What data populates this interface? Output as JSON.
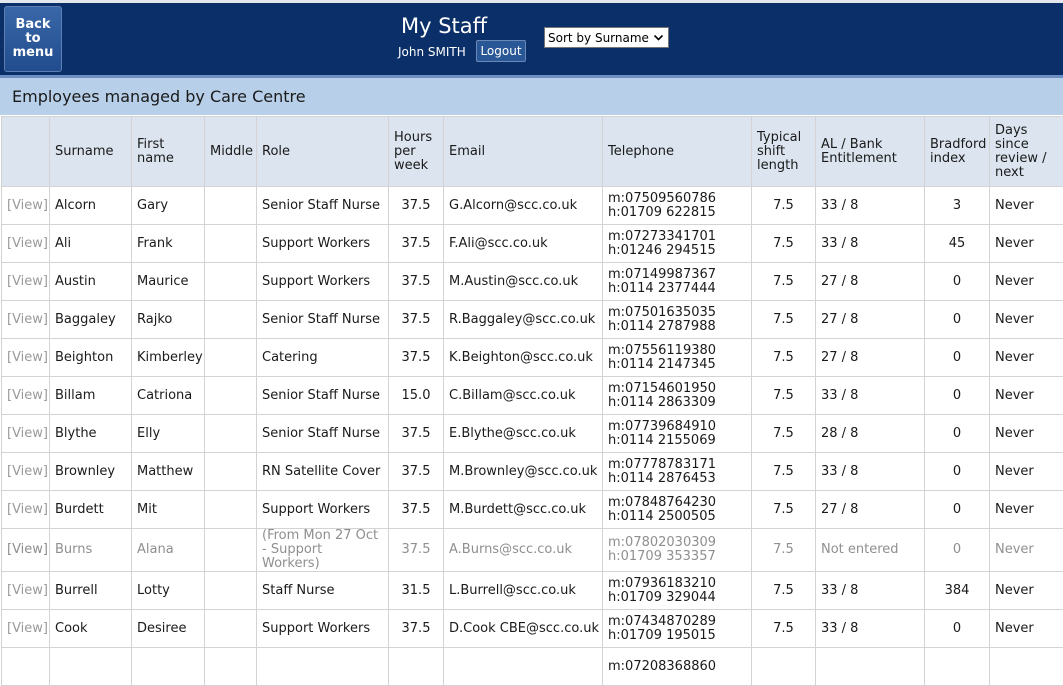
{
  "header": {
    "back_label_lines": [
      "Back",
      "to",
      "menu"
    ],
    "title": "My Staff",
    "user_name": "John SMITH",
    "logout_label": "Logout",
    "sort": {
      "selected": "Sort by Surname"
    }
  },
  "section": {
    "title": "Employees managed by Care Centre"
  },
  "table": {
    "columns": [
      "",
      "Surname",
      "First name",
      "Middle",
      "Role",
      "Hours per week",
      "Email",
      "Telephone",
      "Typical shift length",
      "AL / Bank Entitlement",
      "Bradford index",
      "Days since review / next"
    ],
    "rows": [
      {
        "view": "[View]",
        "surname": "Alcorn",
        "first": "Gary",
        "middle": "",
        "role": "Senior Staff Nurse",
        "hours": "37.5",
        "email": "G.Alcorn@scc.co.uk",
        "mobile": "m:07509560786",
        "home": "h:01709 622815",
        "shift": "7.5",
        "al": "33 / 8",
        "bradford": "3",
        "days": "Never"
      },
      {
        "view": "[View]",
        "surname": "Ali",
        "first": "Frank",
        "middle": "",
        "role": "Support Workers",
        "hours": "37.5",
        "email": "F.Ali@scc.co.uk",
        "mobile": "m:07273341701",
        "home": "h:01246 294515",
        "shift": "7.5",
        "al": "33 / 8",
        "bradford": "45",
        "days": "Never"
      },
      {
        "view": "[View]",
        "surname": "Austin",
        "first": "Maurice",
        "middle": "",
        "role": "Support Workers",
        "hours": "37.5",
        "email": "M.Austin@scc.co.uk",
        "mobile": "m:07149987367",
        "home": "h:0114 2377444",
        "shift": "7.5",
        "al": "27 / 8",
        "bradford": "0",
        "days": "Never"
      },
      {
        "view": "[View]",
        "surname": "Baggaley",
        "first": "Rajko",
        "middle": "",
        "role": "Senior Staff Nurse",
        "hours": "37.5",
        "email": "R.Baggaley@scc.co.uk",
        "mobile": "m:07501635035",
        "home": "h:0114 2787988",
        "shift": "7.5",
        "al": "27 / 8",
        "bradford": "0",
        "days": "Never"
      },
      {
        "view": "[View]",
        "surname": "Beighton",
        "first": "Kimberley",
        "middle": "",
        "role": "Catering",
        "hours": "37.5",
        "email": "K.Beighton@scc.co.uk",
        "mobile": "m:07556119380",
        "home": "h:0114 2147345",
        "shift": "7.5",
        "al": "27 / 8",
        "bradford": "0",
        "days": "Never"
      },
      {
        "view": "[View]",
        "surname": "Billam",
        "first": "Catriona",
        "middle": "",
        "role": "Senior Staff Nurse",
        "hours": "15.0",
        "email": "C.Billam@scc.co.uk",
        "mobile": "m:07154601950",
        "home": "h:0114 2863309",
        "shift": "7.5",
        "al": "33 / 8",
        "bradford": "0",
        "days": "Never"
      },
      {
        "view": "[View]",
        "surname": "Blythe",
        "first": "Elly",
        "middle": "",
        "role": "Senior Staff Nurse",
        "hours": "37.5",
        "email": "E.Blythe@scc.co.uk",
        "mobile": "m:07739684910",
        "home": "h:0114 2155069",
        "shift": "7.5",
        "al": "28 / 8",
        "bradford": "0",
        "days": "Never"
      },
      {
        "view": "[View]",
        "surname": "Brownley",
        "first": "Matthew",
        "middle": "",
        "role": "RN Satellite Cover",
        "hours": "37.5",
        "email": "M.Brownley@scc.co.uk",
        "mobile": "m:07778783171",
        "home": "h:0114 2876453",
        "shift": "7.5",
        "al": "33 / 8",
        "bradford": "0",
        "days": "Never"
      },
      {
        "view": "[View]",
        "surname": "Burdett",
        "first": "Mit",
        "middle": "",
        "role": "Support Workers",
        "hours": "37.5",
        "email": "M.Burdett@scc.co.uk",
        "mobile": "m:07848764230",
        "home": "h:0114 2500505",
        "shift": "7.5",
        "al": "27 / 8",
        "bradford": "0",
        "days": "Never"
      },
      {
        "view": "[View]",
        "surname": "Burns",
        "first": "Alana",
        "middle": "",
        "role": "(From Mon 27 Oct - Support Workers)",
        "hours": "37.5",
        "email": "A.Burns@scc.co.uk",
        "mobile": "m:07802030309",
        "home": "h:01709 353357",
        "shift": "7.5",
        "al": "Not entered",
        "bradford": "0",
        "days": "Never",
        "dim": true
      },
      {
        "view": "[View]",
        "surname": "Burrell",
        "first": "Lotty",
        "middle": "",
        "role": "Staff Nurse",
        "hours": "31.5",
        "email": "L.Burrell@scc.co.uk",
        "mobile": "m:07936183210",
        "home": "h:01709 329044",
        "shift": "7.5",
        "al": "33 / 8",
        "bradford": "384",
        "days": "Never"
      },
      {
        "view": "[View]",
        "surname": "Cook",
        "first": "Desiree",
        "middle": "",
        "role": "Support Workers",
        "hours": "37.5",
        "email": "D.Cook CBE@scc.co.uk",
        "mobile": "m:07434870289",
        "home": "h:01709 195015",
        "shift": "7.5",
        "al": "33 / 8",
        "bradford": "0",
        "days": "Never"
      },
      {
        "view": "",
        "surname": "",
        "first": "",
        "middle": "",
        "role": "",
        "hours": "",
        "email": "",
        "mobile": "m:07208368860",
        "home": "",
        "shift": "",
        "al": "",
        "bradford": "",
        "days": ""
      }
    ]
  }
}
